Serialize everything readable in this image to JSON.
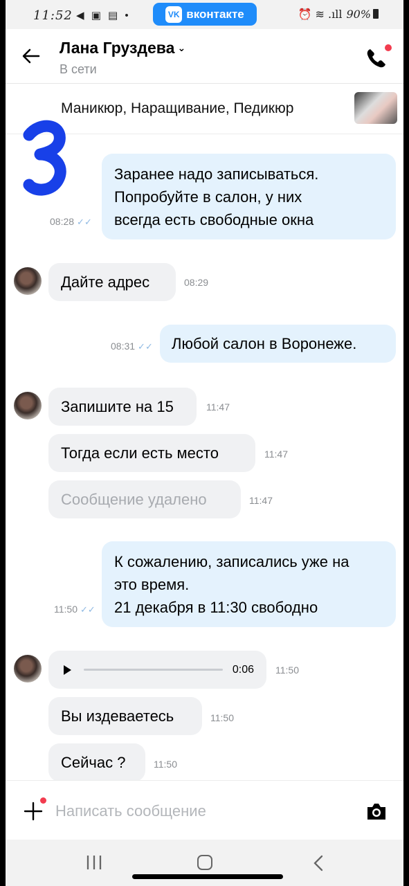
{
  "status_bar": {
    "time": "11:52",
    "left_icons": "◀ ▣ ▤ •",
    "app_badge": "вконтакте",
    "vk_logo": "VK",
    "right_icons": "⏰ ≋ .ıll",
    "battery": "90%"
  },
  "header": {
    "name": "Лана Груздева",
    "status": "В сети"
  },
  "pinned": {
    "text": "Маникюр, Наращивание, Педикюр"
  },
  "messages": [
    {
      "dir": "out",
      "text": "Заранее надо записываться.\nПопробуйте в салон, у них\nвсегда есть свободные окна",
      "time": "08:28"
    },
    {
      "dir": "in",
      "text": "Дайте адрес",
      "time": "08:29"
    },
    {
      "dir": "out",
      "text": "Любой салон в Воронеже.",
      "time": "08:31"
    },
    {
      "dir": "in",
      "text": "Запишите на 15",
      "time": "11:47"
    },
    {
      "dir": "in",
      "text": "Тогда если есть место",
      "time": "11:47"
    },
    {
      "dir": "in",
      "text": "Сообщение удалено",
      "time": "11:47",
      "deleted": true
    },
    {
      "dir": "out",
      "text": "К сожалению, записались уже на\nэто время.\n21 декабря в 11:30 свободно",
      "time": "11:50"
    },
    {
      "dir": "in",
      "type": "voice",
      "duration": "0:06",
      "time": "11:50",
      "progress": 0
    },
    {
      "dir": "in",
      "text": "Вы издеваетесь",
      "time": "11:50"
    },
    {
      "dir": "in",
      "text": "Сейчас ?",
      "time": "11:50"
    }
  ],
  "composer": {
    "placeholder": "Написать сообщение"
  },
  "colors": {
    "accent": "#1f8cfa",
    "outgoing_bubble": "#e4f2fd",
    "incoming_bubble": "#f0f1f3",
    "notification_dot": "#f23c4f"
  },
  "icons": [
    "back-arrow-icon",
    "chevron-down-icon",
    "phone-icon",
    "play-icon",
    "plus-icon",
    "camera-icon",
    "nav-recents-icon",
    "nav-home-icon",
    "nav-back-icon"
  ]
}
